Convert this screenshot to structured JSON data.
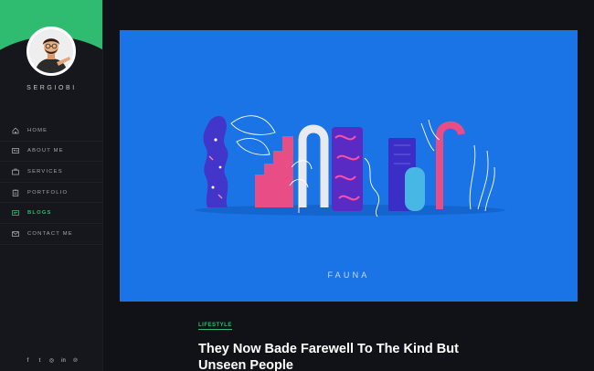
{
  "sidebar": {
    "brand": "SERGIOBI",
    "accent_color": "#2fbb70",
    "nav": [
      {
        "label": "HOME",
        "icon": "home-icon",
        "active": false
      },
      {
        "label": "ABOUT ME",
        "icon": "id-card-icon",
        "active": false
      },
      {
        "label": "SERVICES",
        "icon": "briefcase-icon",
        "active": false
      },
      {
        "label": "PORTFOLIO",
        "icon": "clipboard-icon",
        "active": false
      },
      {
        "label": "BLOGS",
        "icon": "blog-icon",
        "active": true
      },
      {
        "label": "CONTACT ME",
        "icon": "contact-icon",
        "active": false
      }
    ],
    "social": [
      {
        "glyph": "f",
        "icon": "facebook-icon"
      },
      {
        "glyph": "t",
        "icon": "twitter-icon"
      },
      {
        "glyph": "◎",
        "icon": "instagram-icon"
      },
      {
        "glyph": "in",
        "icon": "linkedin-icon"
      },
      {
        "glyph": "℗",
        "icon": "pinterest-icon"
      }
    ]
  },
  "hero": {
    "title": "FAUNA",
    "background_color": "#1a74e6"
  },
  "post": {
    "category": "LIFESTYLE",
    "title": "They Now Bade Farewell To The Kind But Unseen People"
  }
}
